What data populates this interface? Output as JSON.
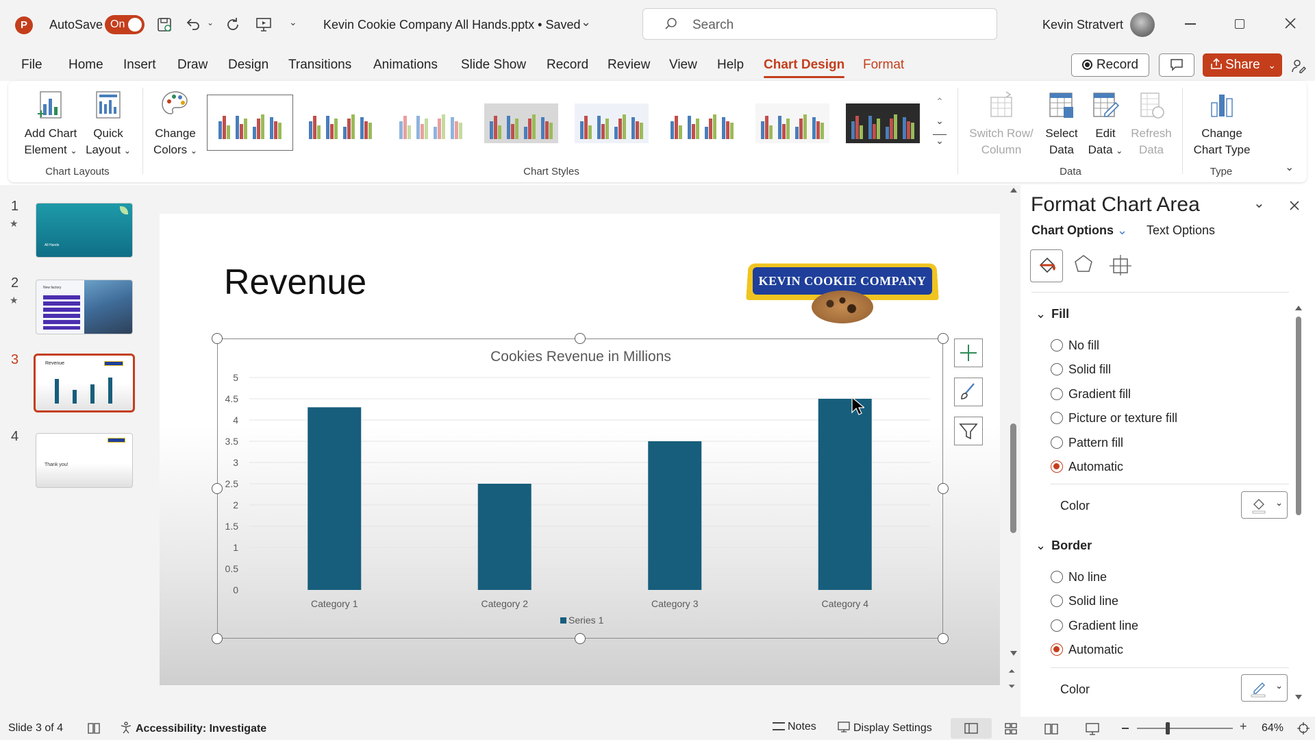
{
  "titlebar": {
    "autosave_label": "AutoSave",
    "autosave_state": "On",
    "file_title": "Kevin Cookie Company All Hands.pptx • Saved",
    "search_placeholder": "Search",
    "user_name": "Kevin Stratvert"
  },
  "tabs": [
    "File",
    "Home",
    "Insert",
    "Draw",
    "Design",
    "Transitions",
    "Animations",
    "Slide Show",
    "Record",
    "Review",
    "View",
    "Help",
    "Chart Design",
    "Format"
  ],
  "actions": {
    "record": "Record",
    "share": "Share"
  },
  "ribbon": {
    "add_chart_element": [
      "Add Chart",
      "Element"
    ],
    "quick_layout": [
      "Quick",
      "Layout"
    ],
    "change_colors": [
      "Change",
      "Colors"
    ],
    "chart_layouts_label": "Chart Layouts",
    "chart_styles_label": "Chart Styles",
    "switch_row_column": [
      "Switch Row/",
      "Column"
    ],
    "select_data": [
      "Select",
      "Data"
    ],
    "edit_data": [
      "Edit",
      "Data"
    ],
    "refresh_data": [
      "Refresh",
      "Data"
    ],
    "data_label": "Data",
    "change_chart_type": [
      "Change",
      "Chart Type"
    ],
    "type_label": "Type"
  },
  "slides": [
    {
      "num": "1",
      "star": "★",
      "text": "All Hands"
    },
    {
      "num": "2",
      "star": "★",
      "text": "New factory"
    },
    {
      "num": "3",
      "star": "",
      "text": "Revenue"
    },
    {
      "num": "4",
      "star": "",
      "text": "Thank you!"
    }
  ],
  "slide": {
    "title": "Revenue",
    "logo_text": "KEVIN COOKIE COMPANY"
  },
  "chart_data": {
    "type": "bar",
    "title": "Cookies Revenue in Millions",
    "categories": [
      "Category 1",
      "Category 2",
      "Category 3",
      "Category 4"
    ],
    "series": [
      {
        "name": "Series 1",
        "values": [
          4.3,
          2.5,
          3.5,
          4.5
        ]
      }
    ],
    "ylim": [
      0,
      5
    ],
    "yticks": [
      "0",
      "0.5",
      "1",
      "1.5",
      "2",
      "2.5",
      "3",
      "3.5",
      "4",
      "4.5",
      "5"
    ],
    "grid": true,
    "legend": "bottom",
    "bar_color": "#175e7c"
  },
  "pane": {
    "title": "Format Chart Area",
    "tab_chart_options": "Chart Options",
    "tab_text_options": "Text Options",
    "fill_header": "Fill",
    "fill_options": [
      "No fill",
      "Solid fill",
      "Gradient fill",
      "Picture or texture fill",
      "Pattern fill",
      "Automatic"
    ],
    "fill_selected": "Automatic",
    "color_label": "Color",
    "border_header": "Border",
    "border_options": [
      "No line",
      "Solid line",
      "Gradient line",
      "Automatic"
    ],
    "border_selected": "Automatic",
    "border_color_label": "Color"
  },
  "status": {
    "slide_info": "Slide 3 of 4",
    "accessibility": "Accessibility: Investigate",
    "notes": "Notes",
    "display_settings": "Display Settings",
    "zoom": "64%"
  },
  "colors": {
    "accent": "#c43e1c",
    "bar": "#175e7c"
  }
}
